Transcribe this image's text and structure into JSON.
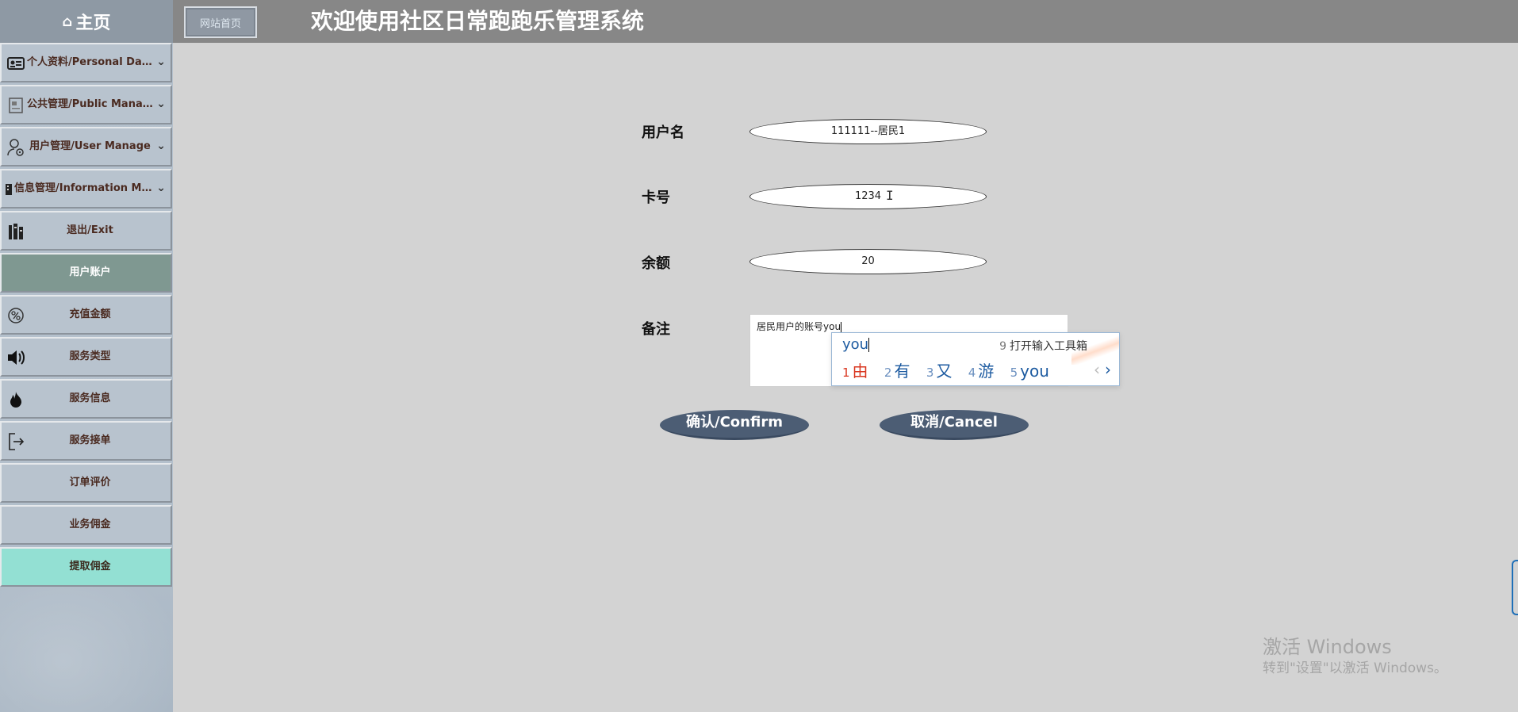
{
  "header": {
    "home_icon": "home-icon",
    "home_label": "主页",
    "site_home_button": "网站首页",
    "title": "欢迎使用社区日常跑跑乐管理系统"
  },
  "sidebar": {
    "items": [
      {
        "label": "个人资料/Personal Data",
        "icon": "id-card-icon",
        "chevron": "﹀"
      },
      {
        "label": "公共管理/Public Manage",
        "icon": "document-icon",
        "chevron": "﹀"
      },
      {
        "label": "用户管理/User Manage",
        "icon": "user-settings-icon",
        "chevron": "﹀"
      },
      {
        "label": "信息管理/Information Man...",
        "icon": "building-icon",
        "chevron": "﹀"
      },
      {
        "label": "退出/Exit",
        "icon": "books-icon"
      },
      {
        "label": "用户账户",
        "icon": ""
      },
      {
        "label": "充值金额",
        "icon": "settings-circle-icon"
      },
      {
        "label": "服务类型",
        "icon": "speaker-icon"
      },
      {
        "label": "服务信息",
        "icon": "fire-icon"
      },
      {
        "label": "服务接单",
        "icon": "logout-icon"
      },
      {
        "label": "订单评价",
        "icon": ""
      },
      {
        "label": "业务佣金",
        "icon": ""
      },
      {
        "label": "提取佣金",
        "icon": ""
      }
    ]
  },
  "form": {
    "username_label": "用户名",
    "username_value": "111111--居民1",
    "card_label": "卡号",
    "card_value": "1234",
    "balance_label": "余额",
    "balance_value": "20",
    "remark_label": "备注",
    "remark_value": "居民用户的账号you",
    "confirm_button": "确认/Confirm",
    "cancel_button": "取消/Cancel"
  },
  "ime": {
    "composition": "you",
    "toolbox_num": "9",
    "toolbox_label": "打开输入工具箱",
    "candidates": [
      {
        "n": "1",
        "text": "由"
      },
      {
        "n": "2",
        "text": "有"
      },
      {
        "n": "3",
        "text": "又"
      },
      {
        "n": "4",
        "text": "游"
      },
      {
        "n": "5",
        "text": "you"
      }
    ],
    "prev": "‹",
    "next": "›"
  },
  "watermark": {
    "line1": "激活 Windows",
    "line2": "转到\"设置\"以激活 Windows。"
  }
}
